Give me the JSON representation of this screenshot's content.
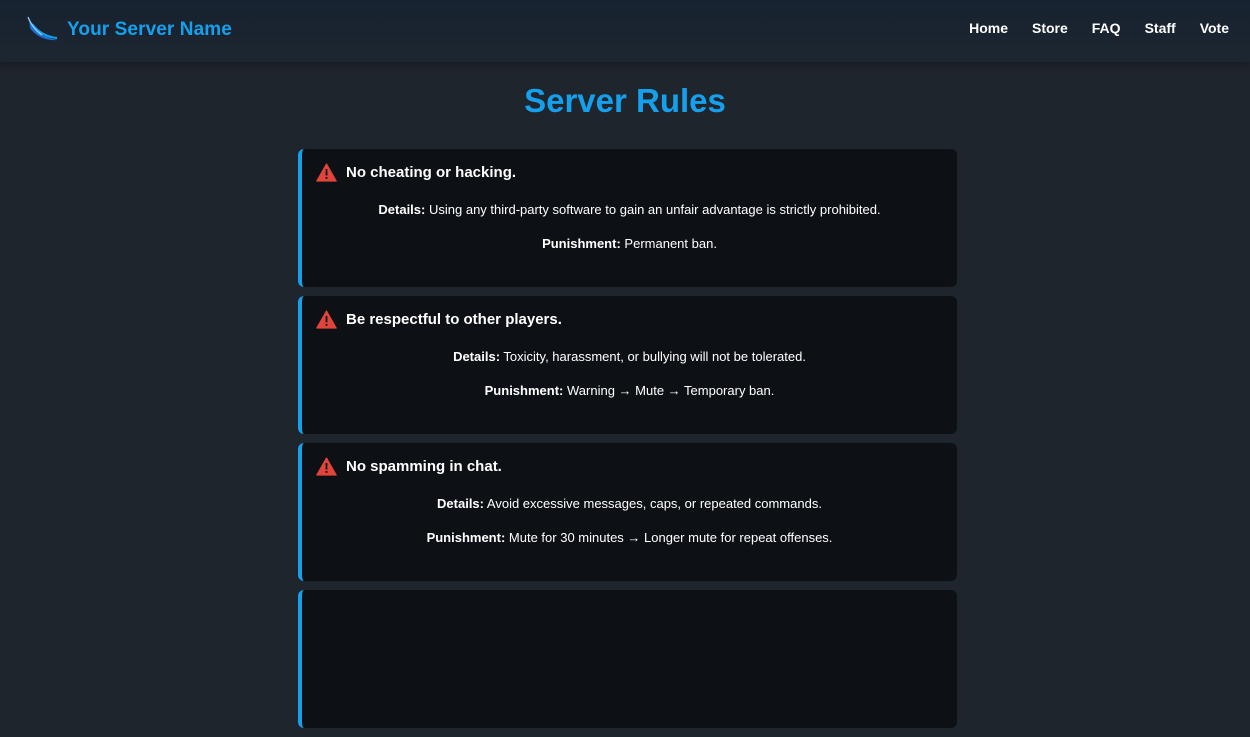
{
  "header": {
    "brand": "Your Server Name",
    "brand_color": "#15a0ee",
    "logo_icon": "wing-swoosh-icon",
    "nav": [
      "Home",
      "Store",
      "FAQ",
      "Staff",
      "Vote"
    ]
  },
  "page": {
    "title": "Server Rules"
  },
  "rules": [
    {
      "icon": "warning-icon",
      "title": "No cheating or hacking.",
      "details_label": "Details:",
      "details": "Using any third-party software to gain an unfair advantage is strictly prohibited.",
      "punishment_label": "Punishment:",
      "punishment": "Permanent ban."
    },
    {
      "icon": "warning-icon",
      "title": "Be respectful to other players.",
      "details_label": "Details:",
      "details": "Toxicity, harassment, or bullying will not be tolerated.",
      "punishment_label": "Punishment:",
      "punishment": "Warning → Mute → Temporary ban."
    },
    {
      "icon": "warning-icon",
      "title": "No spamming in chat.",
      "details_label": "Details:",
      "details": "Avoid excessive messages, caps, or repeated commands.",
      "punishment_label": "Punishment:",
      "punishment": "Mute for 30 minutes → Longer mute for repeat offenses."
    }
  ],
  "colors": {
    "accent": "#15a0ee",
    "warning": "#e0443a",
    "card_bg": "#0d1116",
    "page_bg": "#1f252d"
  }
}
